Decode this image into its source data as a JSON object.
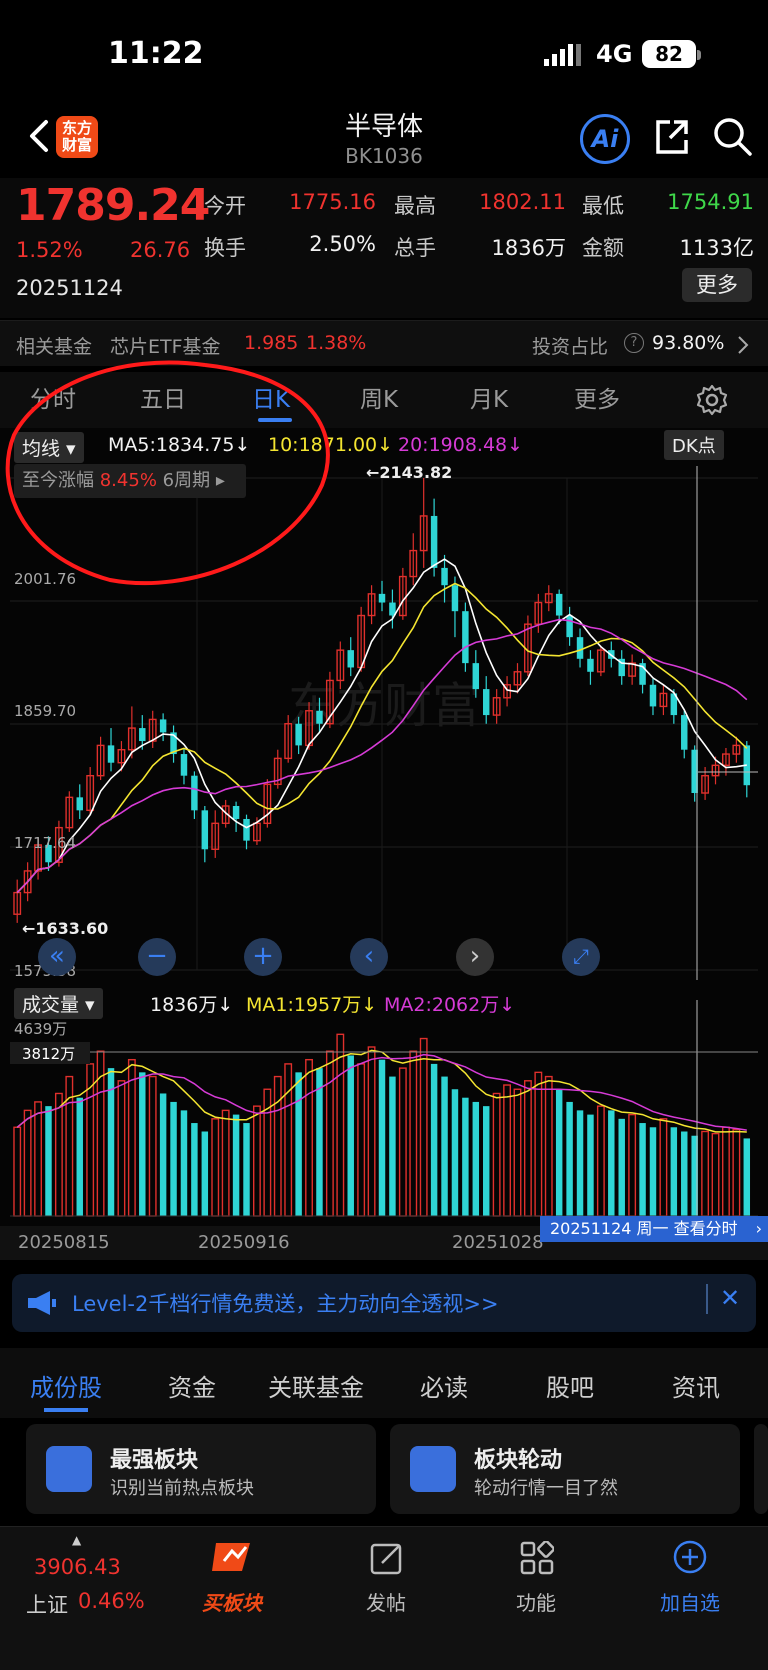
{
  "status": {
    "time": "11:22",
    "network": "4G",
    "battery": "82"
  },
  "header": {
    "title": "半导体",
    "code": "BK1036",
    "logo": "东方\n财富",
    "ai": "Ai"
  },
  "quote": {
    "price": "1789.24",
    "change_pct": "1.52%",
    "change_amt": "26.76",
    "date": "20251124",
    "open_label": "今开",
    "open": "1775.16",
    "high_label": "最高",
    "high": "1802.11",
    "low_label": "最低",
    "low": "1754.91",
    "turnover_label": "换手",
    "turnover": "2.50%",
    "volume_label": "总手",
    "volume": "1836万",
    "amount_label": "金额",
    "amount": "1133亿",
    "more": "更多"
  },
  "fund": {
    "label": "相关基金",
    "name": "芯片ETF基金",
    "price": "1.985",
    "pct": "1.38%",
    "ratio_label": "投资占比",
    "ratio": "93.80%"
  },
  "period_tabs": {
    "minute": "分时",
    "five_day": "五日",
    "day": "日K",
    "week": "周K",
    "month": "月K",
    "more": "更多"
  },
  "indicator": {
    "type": "均线",
    "ma5": "MA5:1834.75↓",
    "ma10": "10:1871.00↓",
    "ma20": "20:1908.48↓",
    "dk": "DK点"
  },
  "range_box": {
    "label": "至今涨幅",
    "pct": "8.45%",
    "period": "6周期"
  },
  "price_axis": {
    "p1": "2001.76",
    "p2": "1859.70",
    "p3": "1717.64",
    "p4": "1575.58",
    "max_label": "←2143.82",
    "min_label": "←1633.60"
  },
  "volume_bar": {
    "type": "成交量",
    "vol": "1836万↓",
    "ma1": "MA1:1957万↓",
    "ma2": "MA2:2062万↓",
    "v1": "4639万",
    "v2": "3812万"
  },
  "x_axis": {
    "d1": "20250815",
    "d2": "20250916",
    "d3": "20251028"
  },
  "tooltip": "20251124 周一  查看分时",
  "watermark": "东方财富",
  "banner": "Level-2千档行情免费送，主力动向全透视>>",
  "content_tabs": {
    "stocks": "成份股",
    "funds": "资金",
    "related": "关联基金",
    "must": "必读",
    "forum": "股吧",
    "news": "资讯"
  },
  "cards": [
    {
      "title": "最强板块",
      "sub": "识别当前热点板块"
    },
    {
      "title": "板块轮动",
      "sub": "轮动行情一目了然"
    }
  ],
  "bottom_nav": {
    "index_value": "3906.43",
    "index_name": "上证",
    "index_pct": "0.46%",
    "buy": "买板块",
    "post": "发帖",
    "func": "功能",
    "add": "加自选"
  },
  "chart_data": {
    "type": "candlestick",
    "y_range": [
      1575.58,
      2143.82
    ],
    "candles": [
      [
        1640,
        1665,
        1630,
        1680
      ],
      [
        1665,
        1690,
        1655,
        1700
      ],
      [
        1690,
        1720,
        1680,
        1728
      ],
      [
        1720,
        1700,
        1690,
        1730
      ],
      [
        1700,
        1740,
        1695,
        1748
      ],
      [
        1740,
        1775,
        1735,
        1782
      ],
      [
        1775,
        1760,
        1750,
        1790
      ],
      [
        1760,
        1800,
        1755,
        1810
      ],
      [
        1800,
        1835,
        1795,
        1845
      ],
      [
        1835,
        1815,
        1805,
        1855
      ],
      [
        1815,
        1830,
        1805,
        1840
      ],
      [
        1830,
        1855,
        1820,
        1880
      ],
      [
        1855,
        1840,
        1830,
        1870
      ],
      [
        1840,
        1865,
        1832,
        1875
      ],
      [
        1865,
        1850,
        1840,
        1872
      ],
      [
        1850,
        1825,
        1815,
        1858
      ],
      [
        1825,
        1800,
        1790,
        1832
      ],
      [
        1800,
        1760,
        1750,
        1805
      ],
      [
        1760,
        1715,
        1700,
        1765
      ],
      [
        1715,
        1745,
        1705,
        1760
      ],
      [
        1745,
        1765,
        1740,
        1772
      ],
      [
        1765,
        1750,
        1735,
        1770
      ],
      [
        1750,
        1725,
        1715,
        1755
      ],
      [
        1725,
        1745,
        1720,
        1752
      ],
      [
        1745,
        1790,
        1740,
        1796
      ],
      [
        1790,
        1820,
        1785,
        1830
      ],
      [
        1820,
        1860,
        1815,
        1870
      ],
      [
        1860,
        1835,
        1825,
        1868
      ],
      [
        1835,
        1875,
        1830,
        1885
      ],
      [
        1875,
        1860,
        1850,
        1890
      ],
      [
        1860,
        1910,
        1855,
        1920
      ],
      [
        1910,
        1945,
        1900,
        1955
      ],
      [
        1945,
        1925,
        1915,
        1960
      ],
      [
        1925,
        1985,
        1920,
        1995
      ],
      [
        1985,
        2010,
        1975,
        2020
      ],
      [
        2010,
        2000,
        1990,
        2025
      ],
      [
        2000,
        1985,
        1970,
        2015
      ],
      [
        1985,
        2030,
        1980,
        2040
      ],
      [
        2030,
        2060,
        2020,
        2080
      ],
      [
        2060,
        2100,
        2040,
        2143.82
      ],
      [
        2100,
        2040,
        2030,
        2120
      ],
      [
        2040,
        2020,
        2000,
        2055
      ],
      [
        2020,
        1990,
        1960,
        2030
      ],
      [
        1990,
        1930,
        1920,
        2000
      ],
      [
        1930,
        1900,
        1890,
        1945
      ],
      [
        1900,
        1870,
        1860,
        1915
      ],
      [
        1870,
        1890,
        1860,
        1900
      ],
      [
        1890,
        1905,
        1880,
        1915
      ],
      [
        1905,
        1920,
        1895,
        1930
      ],
      [
        1920,
        1975,
        1915,
        1985
      ],
      [
        1975,
        2000,
        1965,
        2010
      ],
      [
        2000,
        2010,
        1990,
        2020
      ],
      [
        2010,
        1985,
        1975,
        2015
      ],
      [
        1985,
        1960,
        1950,
        1995
      ],
      [
        1960,
        1935,
        1925,
        1970
      ],
      [
        1935,
        1920,
        1905,
        1945
      ],
      [
        1920,
        1945,
        1915,
        1950
      ],
      [
        1945,
        1935,
        1925,
        1955
      ],
      [
        1935,
        1915,
        1905,
        1945
      ],
      [
        1915,
        1930,
        1905,
        1940
      ],
      [
        1930,
        1905,
        1895,
        1935
      ],
      [
        1905,
        1880,
        1870,
        1912
      ],
      [
        1880,
        1895,
        1870,
        1905
      ],
      [
        1895,
        1870,
        1860,
        1900
      ],
      [
        1870,
        1830,
        1820,
        1875
      ],
      [
        1830,
        1780,
        1770,
        1835
      ],
      [
        1780,
        1800,
        1772,
        1810
      ],
      [
        1800,
        1812,
        1790,
        1822
      ],
      [
        1812,
        1825,
        1800,
        1832
      ],
      [
        1825,
        1835,
        1815,
        1845
      ],
      [
        1835,
        1789,
        1775,
        1840
      ]
    ],
    "volume_range": [
      0,
      4639
    ],
    "volumes": [
      2100,
      2500,
      2700,
      2600,
      2900,
      3300,
      2800,
      3600,
      3900,
      3500,
      3200,
      3700,
      3400,
      3300,
      2900,
      2700,
      2500,
      2200,
      2000,
      2300,
      2500,
      2400,
      2200,
      2600,
      3000,
      3300,
      3600,
      3400,
      3700,
      3500,
      3900,
      4300,
      3800,
      3600,
      4000,
      3700,
      3300,
      3500,
      3900,
      4200,
      3600,
      3300,
      3000,
      2800,
      2700,
      2600,
      2900,
      3100,
      3000,
      3200,
      3400,
      3300,
      3000,
      2700,
      2500,
      2400,
      2600,
      2500,
      2300,
      2400,
      2200,
      2100,
      2300,
      2100,
      2000,
      1900,
      2000,
      1950,
      2100,
      2050,
      1836
    ],
    "ma_colors": {
      "ma5": "#ffffff",
      "ma10": "#f4e531",
      "ma20": "#d63bd6"
    },
    "up_color": "#e0302c",
    "down_color": "#2fd6d6"
  }
}
